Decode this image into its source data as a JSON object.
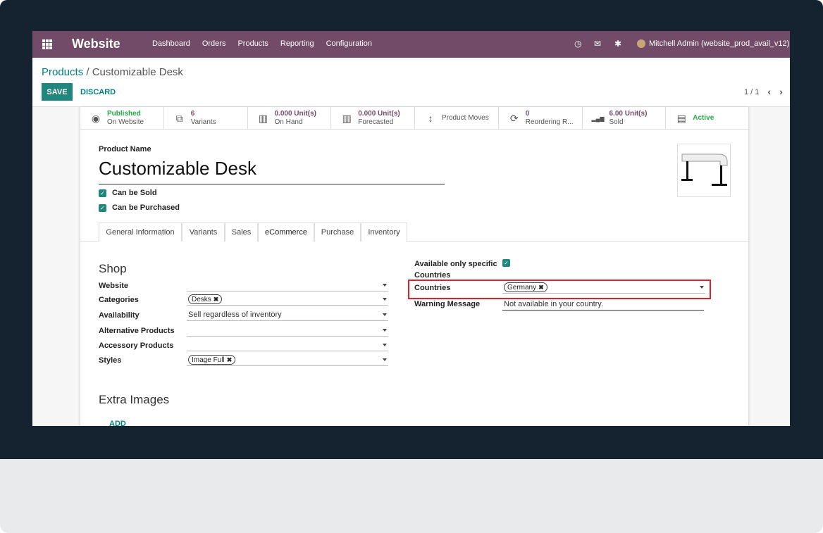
{
  "navbar": {
    "brand": "Website",
    "menu": [
      "Dashboard",
      "Orders",
      "Products",
      "Reporting",
      "Configuration"
    ],
    "user": "Mitchell Admin (website_prod_avail_v12)"
  },
  "breadcrumb": {
    "parent": "Products",
    "separator": "/",
    "current": "Customizable Desk"
  },
  "buttons": {
    "save": "SAVE",
    "discard": "DISCARD"
  },
  "pager": {
    "value": "1 / 1",
    "prev": "‹",
    "next": "›"
  },
  "stats": [
    {
      "value": "Published",
      "label": "On Website",
      "icon": "globe-icon",
      "glyph": "◉",
      "green": true
    },
    {
      "value": "6",
      "label": "Variants",
      "icon": "sitemap-icon",
      "glyph": "⧉"
    },
    {
      "value": "0.000 Unit(s)",
      "label": "On Hand",
      "icon": "building-icon",
      "glyph": "▥"
    },
    {
      "value": "0.000 Unit(s)",
      "label": "Forecasted",
      "icon": "building-icon",
      "glyph": "▥"
    },
    {
      "value": "",
      "label": "Product Moves",
      "icon": "arrows-v-icon",
      "glyph": "↕"
    },
    {
      "value": "0",
      "label": "Reordering R...",
      "icon": "refresh-icon",
      "glyph": "⟳"
    },
    {
      "value": "6.00 Unit(s)",
      "label": "Sold",
      "icon": "signal-icon",
      "glyph": "▂▄▆"
    },
    {
      "value": "Active",
      "label": "",
      "icon": "archive-icon",
      "glyph": "▤",
      "green": true
    }
  ],
  "product": {
    "name_label": "Product Name",
    "name": "Customizable Desk",
    "can_be_sold": "Can be Sold",
    "can_be_purchased": "Can be Purchased"
  },
  "tabs": [
    "General Information",
    "Variants",
    "Sales",
    "eCommerce",
    "Purchase",
    "Inventory"
  ],
  "active_tab": "eCommerce",
  "shop": {
    "title": "Shop",
    "fields": [
      {
        "label": "Website",
        "value": ""
      },
      {
        "label": "Categories",
        "tag": "Desks"
      },
      {
        "label": "Availability",
        "value": "Sell regardless of inventory"
      },
      {
        "label": "Alternative Products",
        "value": ""
      },
      {
        "label": "Accessory Products",
        "value": ""
      },
      {
        "label": "Styles",
        "tag": "Image Full"
      }
    ]
  },
  "countries": {
    "specific_label_1": "Available only specific",
    "specific_label_2": "Countries",
    "countries_label": "Countries",
    "countries_tag": "Germany",
    "warning_label": "Warning Message",
    "warning_value": "Not available in your country."
  },
  "extra_images": {
    "title": "Extra Images",
    "add": "ADD"
  },
  "colors": {
    "navbar": "#714b67",
    "accent": "#21867e",
    "highlight": "#e0202a"
  }
}
